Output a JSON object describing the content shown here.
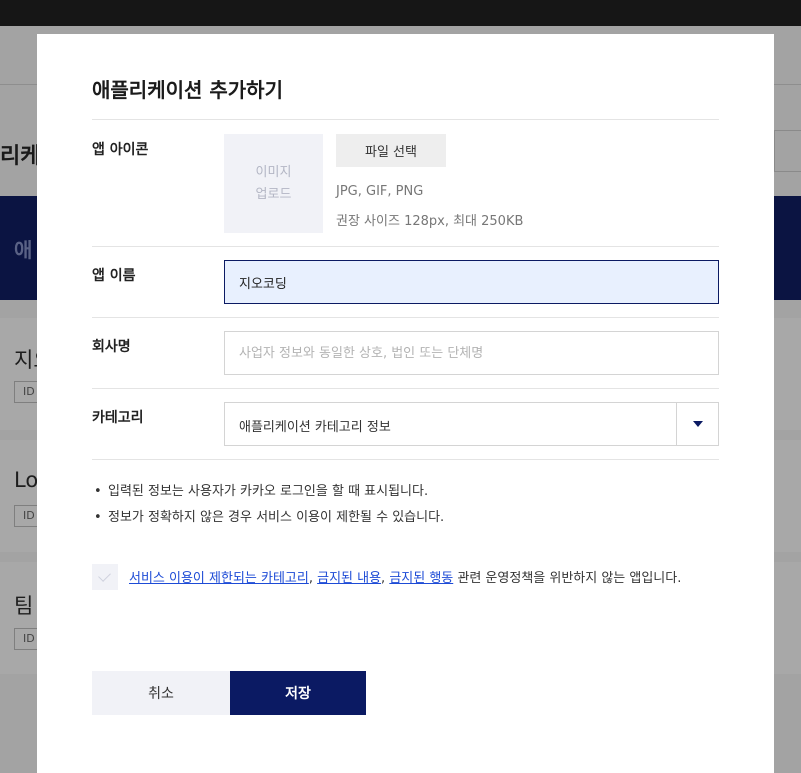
{
  "background": {
    "page_title_fragment": "리케이",
    "banner_text_fragment": "애",
    "cards": [
      {
        "name_fragment": "지오",
        "id_label": "ID"
      },
      {
        "name_fragment": "Lo",
        "id_label": "ID"
      },
      {
        "name_fragment": "팀",
        "id_label": "ID"
      }
    ]
  },
  "modal": {
    "title": "애플리케이션 추가하기",
    "icon_field": {
      "label": "앱 아이콘",
      "upload_line1": "이미지",
      "upload_line2": "업로드",
      "file_button": "파일 선택",
      "hint_formats": "JPG, GIF, PNG",
      "hint_size": "권장 사이즈 128px, 최대 250KB"
    },
    "name_field": {
      "label": "앱 이름",
      "value": "지오코딩"
    },
    "company_field": {
      "label": "회사명",
      "value": "",
      "placeholder": "사업자 정보와 동일한 상호, 법인 또는 단체명"
    },
    "category_field": {
      "label": "카테고리",
      "selected": "애플리케이션 카테고리 정보",
      "arrow_icon": "caret-down-icon"
    },
    "notices": [
      "입력된 정보는 사용자가 카카오 로그인을 할 때 표시됩니다.",
      "정보가 정확하지 않은 경우 서비스 이용이 제한될 수 있습니다."
    ],
    "bullet": "•",
    "policy": {
      "checked": false,
      "link1": "서비스 이용이 제한되는 카테고리",
      "sep1": ", ",
      "link2": "금지된 내용",
      "sep2": ", ",
      "link3": "금지된 행동",
      "text_after": " 관련 운영정책을 위반하지 않는 앱입니다."
    },
    "buttons": {
      "cancel": "취소",
      "save": "저장"
    }
  },
  "colors": {
    "primary": "#0b1a63",
    "link": "#1d4bd6",
    "active_input_bg": "#e8f0fe",
    "overlay": "#9a9a9a"
  }
}
